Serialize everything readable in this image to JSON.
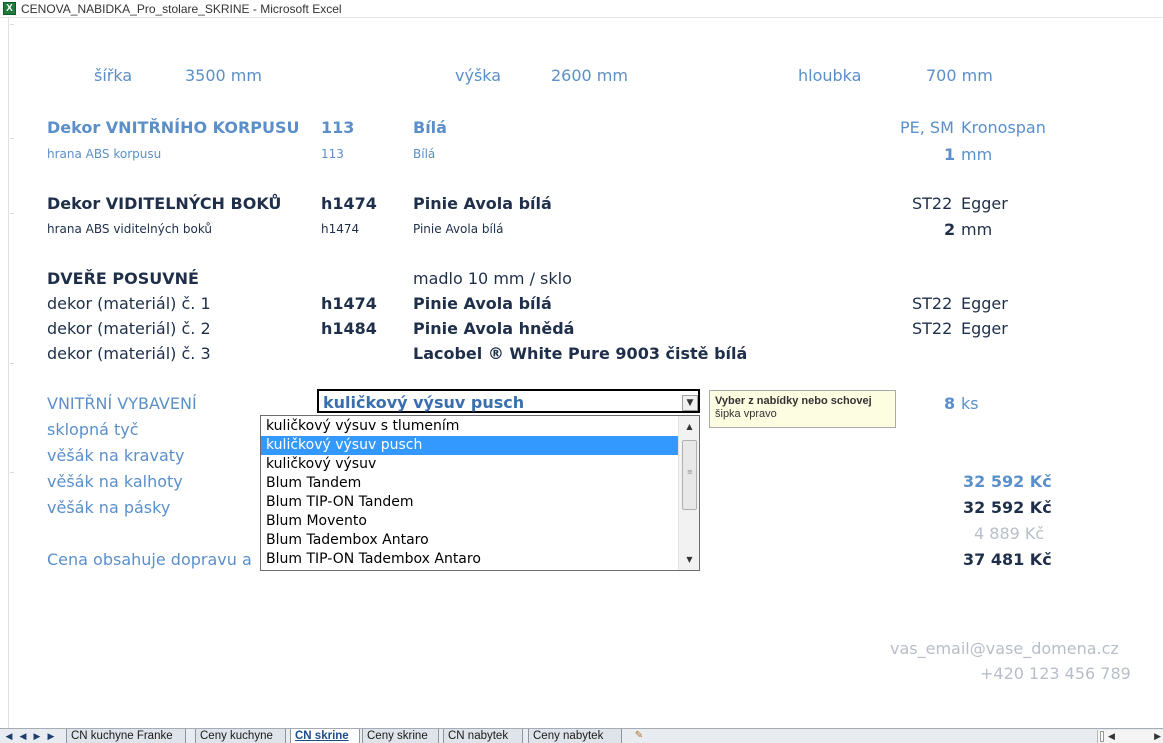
{
  "window": {
    "title": "CENOVA_NABIDKA_Pro_stolare_SKRINE - Microsoft Excel",
    "app_icon": "X"
  },
  "dimensions": {
    "sirka_label": "šířka",
    "sirka_value": "3500 mm",
    "vyska_label": "výška",
    "vyska_value": "2600 mm",
    "hloubka_label": "hloubka",
    "hloubka_value": "700 mm"
  },
  "korpus": {
    "label": "Dekor VNITŘNÍHO KORPUSU",
    "code": "113",
    "name": "Bílá",
    "type": "PE, SM",
    "maker": "Kronospan",
    "edge_label": "hrana ABS korpusu",
    "edge_code": "113",
    "edge_name": "Bílá",
    "edge_thickness": "1",
    "edge_unit": "mm"
  },
  "boky": {
    "label": "Dekor VIDITELNÝCH BOKŮ",
    "code": "h1474",
    "name": "Pinie Avola bílá",
    "type": "ST22",
    "maker": "Egger",
    "edge_label": "hrana ABS viditelných boků",
    "edge_code": "h1474",
    "edge_name": "Pinie Avola bílá",
    "edge_thickness": "2",
    "edge_unit": "mm"
  },
  "dvere": {
    "label": "DVEŘE POSUVNÉ",
    "handle": "madlo 10 mm / sklo",
    "rows": [
      {
        "label": "dekor (materiál) č. 1",
        "code": "h1474",
        "name": "Pinie Avola bílá",
        "type": "ST22",
        "maker": "Egger"
      },
      {
        "label": "dekor (materiál) č. 2",
        "code": "h1484",
        "name": "Pinie Avola hnědá",
        "type": "ST22",
        "maker": "Egger"
      },
      {
        "label": "dekor (materiál) č. 3",
        "code": "",
        "name": "Lacobel ® White Pure 9003 čistě bílá",
        "type": "",
        "maker": ""
      }
    ]
  },
  "vybaveni": {
    "label": "VNITŘNÍ VYBAVENÍ",
    "selected": "kuličkový výsuv pusch",
    "qty": "8",
    "qty_unit": "ks",
    "items": [
      "sklopná tyč",
      "věšák na kravaty",
      "věšák na kalhoty",
      "věšák na pásky"
    ],
    "note_partial": "Cena obsahuje dopravu a"
  },
  "dropdown": {
    "options": [
      "kuličkový výsuv s tlumením",
      "kuličkový výsuv pusch",
      "kuličkový výsuv",
      "Blum Tandem",
      "Blum TIP-ON Tandem",
      "Blum Movento",
      "Blum Tadembox Antaro",
      "Blum TIP-ON Tadembox Antaro"
    ],
    "selected_index": 1
  },
  "tooltip": {
    "line1": "Vyber z nabídky nebo schovej",
    "line2": "šipka vpravo"
  },
  "prices": {
    "p1": "32 592 Kč",
    "p2": "32 592 Kč",
    "p3": "4 889 Kč",
    "total": "37 481 Kč"
  },
  "contact": {
    "email": "vas_email@vase_domena.cz",
    "phone": "+420 123 456 789"
  },
  "sheet_tabs": [
    {
      "label": "CN kuchyne  Franke",
      "active": false
    },
    {
      "label": "Ceny kuchyne",
      "active": false
    },
    {
      "label": "CN skrine",
      "active": true
    },
    {
      "label": "Ceny skrine",
      "active": false
    },
    {
      "label": "CN nabytek",
      "active": false
    },
    {
      "label": "Ceny  nabytek",
      "active": false
    }
  ],
  "colors": {
    "accent_blue": "#5b8fc9",
    "dark_navy": "#1f2f4a",
    "selection": "#3399ff",
    "tooltip_bg": "#fdfde2"
  }
}
